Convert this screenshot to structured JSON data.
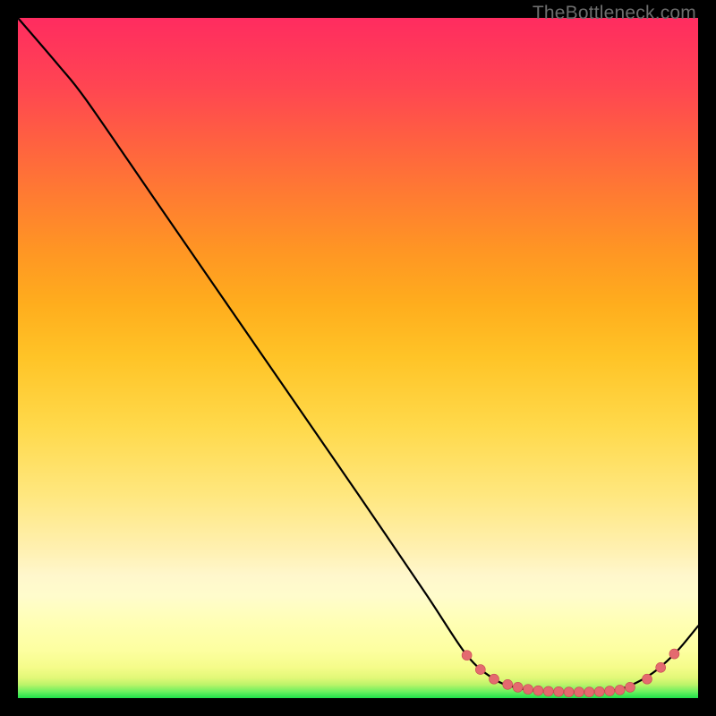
{
  "watermark": "TheBottleneck.com",
  "colors": {
    "curve_stroke": "#000000",
    "dot_fill": "#e46a6f",
    "dot_stroke": "#c94a52",
    "background_black": "#000000"
  },
  "chart_data": {
    "type": "line",
    "title": "",
    "xlabel": "",
    "ylabel": "",
    "xlim": [
      0,
      100
    ],
    "ylim": [
      0,
      100
    ],
    "grid": false,
    "legend": false,
    "series": [
      {
        "name": "bottleneck-curve",
        "x": [
          0,
          6,
          10,
          20,
          30,
          40,
          50,
          60,
          66,
          70,
          73,
          76,
          80,
          84,
          88,
          91,
          94,
          97,
          100
        ],
        "y": [
          100,
          93,
          88,
          73.5,
          59,
          44.5,
          30,
          15.3,
          6.3,
          2.8,
          1.6,
          1.1,
          0.9,
          0.9,
          1.2,
          2.3,
          4.2,
          7.0,
          10.6
        ]
      }
    ],
    "dots": {
      "name": "highlight-dots",
      "x": [
        66,
        68,
        70,
        72,
        73.5,
        75,
        76.5,
        78,
        79.5,
        81,
        82.5,
        84,
        85.5,
        87,
        88.5,
        90,
        92.5,
        94.5,
        96.5
      ],
      "y": [
        6.3,
        4.2,
        2.8,
        2.0,
        1.6,
        1.3,
        1.1,
        1.0,
        0.95,
        0.9,
        0.9,
        0.9,
        0.95,
        1.05,
        1.2,
        1.6,
        2.8,
        4.5,
        6.5
      ]
    }
  }
}
